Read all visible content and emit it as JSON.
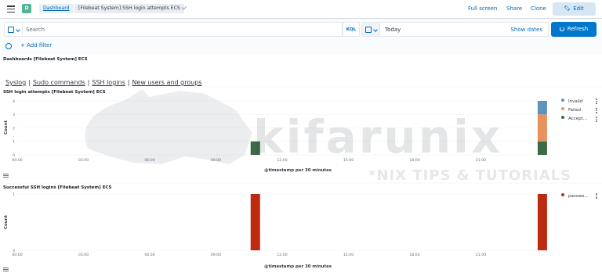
{
  "header": {
    "space_initial": "D",
    "breadcrumb_link": "Dashboard",
    "breadcrumb_current": "[Filebeat System] SSH login attempts ECS",
    "full_screen": "Full screen",
    "share": "Share",
    "clone": "Clone",
    "edit": "Edit"
  },
  "query": {
    "placeholder": "Search",
    "language": "KQL",
    "date_value": "Today",
    "show_dates": "Show dates",
    "refresh": "Refresh"
  },
  "filters": {
    "add_filter": "+ Add filter"
  },
  "nav_panel": {
    "title": "Dashboards [Filebeat System] ECS",
    "links": [
      "Syslog",
      "Sudo commands",
      "SSH logins",
      "New users and groups"
    ]
  },
  "watermark": {
    "brand": "kifarunix",
    "tagline": "*NIX TIPS & TUTORIALS"
  },
  "colors": {
    "invalid": "#6092c0",
    "failed": "#e7925c",
    "accepted": "#3c6a43",
    "password": "#bd2a10"
  },
  "chart_data": [
    {
      "type": "bar",
      "title": "SSH login attempts [Filebeat System] ECS",
      "xlabel": "@timestamp per 30 minutes",
      "ylabel": "Count",
      "x_ticks": [
        "00:00",
        "03:00",
        "06:00",
        "09:00",
        "12:00",
        "15:00",
        "18:00",
        "21:00"
      ],
      "y_ticks": [
        0,
        1,
        2,
        3,
        4
      ],
      "ylim": [
        0,
        4
      ],
      "stacked": true,
      "series": [
        {
          "name": "Accept...",
          "color": "#3c6a43",
          "points": [
            {
              "x": "10:30",
              "y": 1
            },
            {
              "x": "23:30",
              "y": 1
            }
          ]
        },
        {
          "name": "Failed",
          "color": "#e7925c",
          "points": [
            {
              "x": "23:30",
              "y": 2
            }
          ]
        },
        {
          "name": "Invalid",
          "color": "#6092c0",
          "points": [
            {
              "x": "23:30",
              "y": 1
            }
          ]
        }
      ],
      "legend": [
        "Invalid",
        "Failed",
        "Accept..."
      ],
      "legend_placement": "right"
    },
    {
      "type": "bar",
      "title": "Successful SSH logins [Filebeat System] ECS",
      "xlabel": "@timestamp per 30 minutes",
      "ylabel": "Count",
      "x_ticks": [
        "00:00",
        "03:00",
        "06:00",
        "09:00",
        "12:00",
        "15:00",
        "18:00",
        "21:00"
      ],
      "y_ticks": [
        0,
        1
      ],
      "ylim": [
        0,
        1
      ],
      "series": [
        {
          "name": "passwo...",
          "color": "#bd2a10",
          "points": [
            {
              "x": "10:30",
              "y": 1
            },
            {
              "x": "23:30",
              "y": 1
            }
          ]
        }
      ],
      "legend": [
        "passwo..."
      ],
      "legend_placement": "right"
    }
  ]
}
